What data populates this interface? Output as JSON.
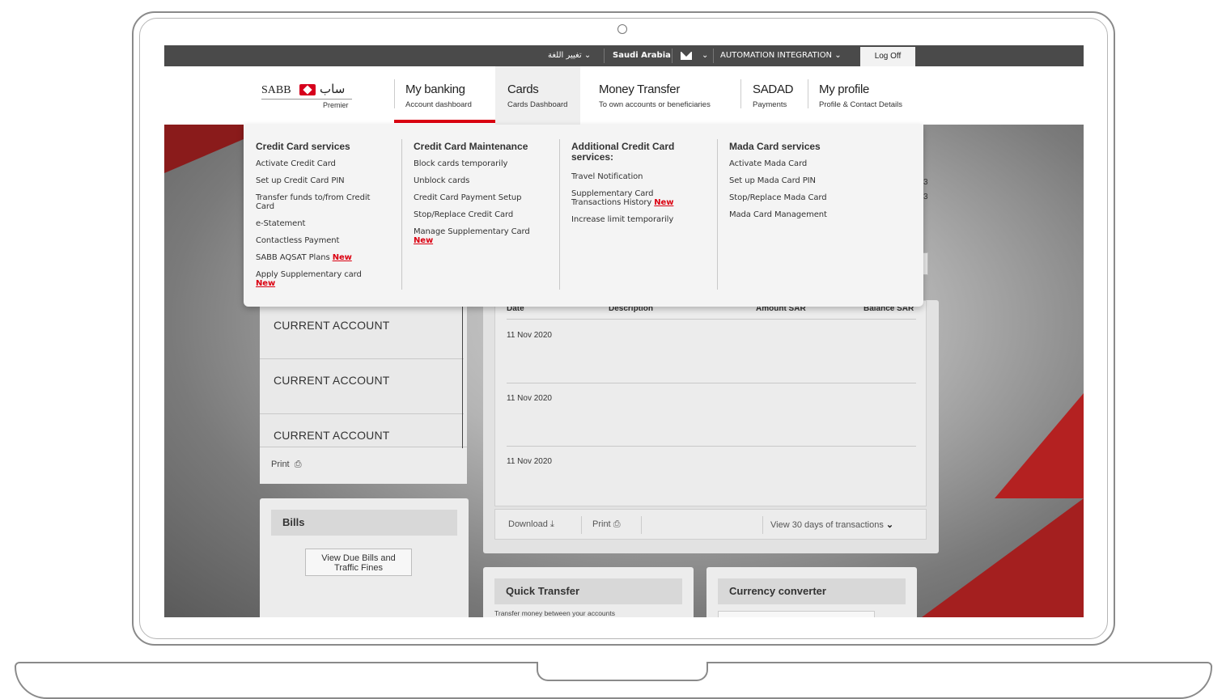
{
  "topbar": {
    "language_label": "تغيير اللغة",
    "country": "Saudi Arabia",
    "user": "AUTOMATION INTEGRATION",
    "logoff": "Log Off"
  },
  "brand": {
    "name_en": "SABB",
    "name_ar": "ساب",
    "tier": "Premier",
    "color": "#db0011"
  },
  "nav": [
    {
      "title": "My banking",
      "sub": "Account dashboard"
    },
    {
      "title": "Cards",
      "sub": "Cards Dashboard"
    },
    {
      "title": "Money Transfer",
      "sub": "To own accounts or beneficiaries"
    },
    {
      "title": "SADAD",
      "sub": "Payments"
    },
    {
      "title": "My profile",
      "sub": "Profile & Contact Details"
    }
  ],
  "mega_menu": {
    "new_label": "New",
    "col1": {
      "heading": "Credit Card services",
      "links": [
        "Activate Credit Card",
        "Set up Credit Card PIN",
        "Transfer funds to/from Credit",
        "Card",
        "e-Statement",
        "Contactless Payment",
        "SABB AQSAT Plans",
        "Apply Supplementary card"
      ]
    },
    "col2": {
      "heading": "Credit Card Maintenance",
      "links": [
        "Block cards temporarily",
        "Unblock cards",
        "Credit Card Payment Setup",
        "Stop/Replace Credit Card",
        "Manage Supplementary Card"
      ]
    },
    "col3": {
      "heading_1": "Additional Credit Card",
      "heading_2": "services:",
      "links": [
        "Travel Notification",
        "Supplementary Card",
        "Transactions History",
        "Increase limit temporarily"
      ]
    },
    "col4": {
      "heading": "Mada Card services",
      "links": [
        "Activate Mada Card",
        "Set up Mada Card PIN",
        "Stop/Replace Mada Card",
        "Mada Card Management"
      ]
    }
  },
  "accounts": {
    "items": [
      "CURRENT ACCOUNT",
      "CURRENT ACCOUNT",
      "CURRENT ACCOUNT"
    ],
    "print_label": "Print"
  },
  "transactions": {
    "columns": [
      "Date",
      "Description",
      "Amount SAR",
      "Balance SAR"
    ],
    "rows": [
      {
        "date": "11 Nov 2020"
      },
      {
        "date": "11 Nov 2020"
      },
      {
        "date": "11 Nov 2020"
      }
    ],
    "download_label": "Download",
    "print_label": "Print",
    "view_label": "View 30 days of transactions"
  },
  "bills": {
    "title": "Bills",
    "button_line1": "View Due Bills and",
    "button_line2": "Traffic Fines"
  },
  "quick_transfer": {
    "title": "Quick Transfer",
    "desc": "Transfer money between your accounts"
  },
  "currency_converter": {
    "title": "Currency converter"
  },
  "peek_digits": [
    "3",
    "3"
  ]
}
